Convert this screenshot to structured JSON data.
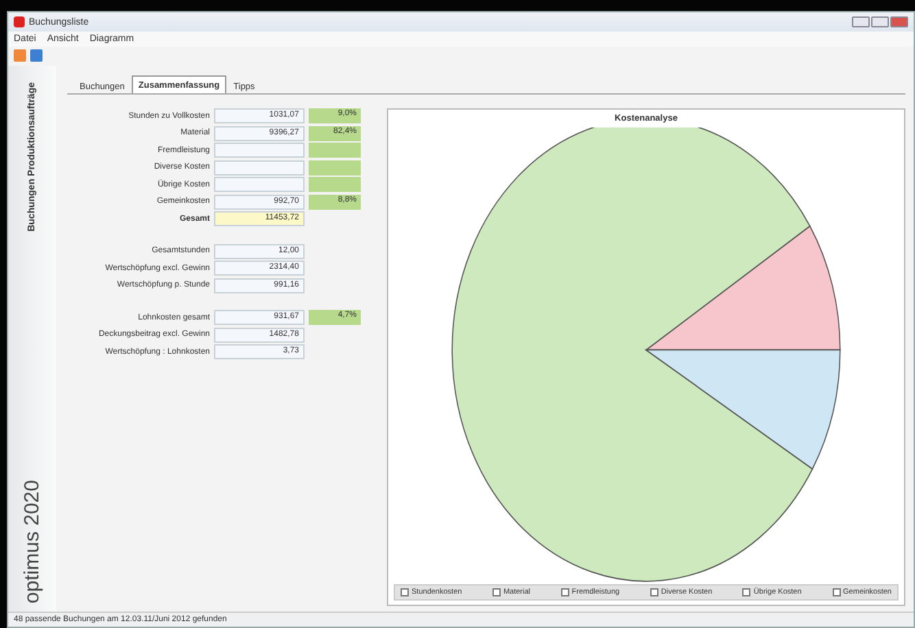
{
  "window": {
    "title": "Buchungsliste"
  },
  "menu": [
    "Datei",
    "Ansicht",
    "Diagramm"
  ],
  "tabs": [
    {
      "label": "Buchungen",
      "selected": false
    },
    {
      "label": "Zusammenfassung",
      "selected": true
    },
    {
      "label": "Tipps",
      "selected": false
    }
  ],
  "sidebar": {
    "caption": "Buchungen Produktionsaufträge",
    "brand": "optimus 2020"
  },
  "sections": [
    {
      "rows": [
        {
          "kind": "cost",
          "label": "Stunden zu Vollkosten",
          "value": "1031,07",
          "percent": "9,0%"
        },
        {
          "kind": "cost",
          "label": "Material",
          "value": "9396,27",
          "percent": "82,4%"
        },
        {
          "kind": "cost",
          "label": "Fremdleistung"
        },
        {
          "kind": "cost",
          "label": "Diverse Kosten"
        },
        {
          "kind": "cost",
          "label": "Übrige Kosten"
        },
        {
          "kind": "cost",
          "label": "Gemeinkosten",
          "value": "992,70",
          "percent": "8,8%"
        },
        {
          "kind": "total",
          "label": "Gesamt",
          "value": "11453,72"
        }
      ]
    },
    {
      "rows": [
        {
          "kind": "plain",
          "label": "Gesamtstunden",
          "value": "12,00"
        },
        {
          "kind": "plain",
          "label": "Wertschöpfung excl. Gewinn",
          "value": "2314,40"
        },
        {
          "kind": "plain",
          "label": "Wertschöpfung p. Stunde",
          "value": "991,16"
        }
      ]
    },
    {
      "rows": [
        {
          "kind": "cost",
          "label": "Lohnkosten gesamt",
          "value": "931,67",
          "percent": "4,7%"
        },
        {
          "kind": "plain",
          "label": "Deckungsbeitrag excl. Gewinn",
          "value": "1482,78"
        },
        {
          "kind": "plain",
          "label": "Wertschöpfung : Lohnkosten",
          "value": "3,73"
        }
      ]
    }
  ],
  "chart": {
    "title": "Kostenanalyse",
    "legend": [
      {
        "label": "Stundenkosten",
        "checked": false
      },
      {
        "label": "Material",
        "checked": false
      },
      {
        "label": "Fremdleistung",
        "checked": false
      },
      {
        "label": "Diverse Kosten",
        "checked": false
      },
      {
        "label": "Übrige Kosten",
        "checked": false
      },
      {
        "label": "Gemeinkosten",
        "checked": false
      }
    ]
  },
  "status_bar": "48 passende Buchungen am 12.03.11/Juni 2012 gefunden"
}
